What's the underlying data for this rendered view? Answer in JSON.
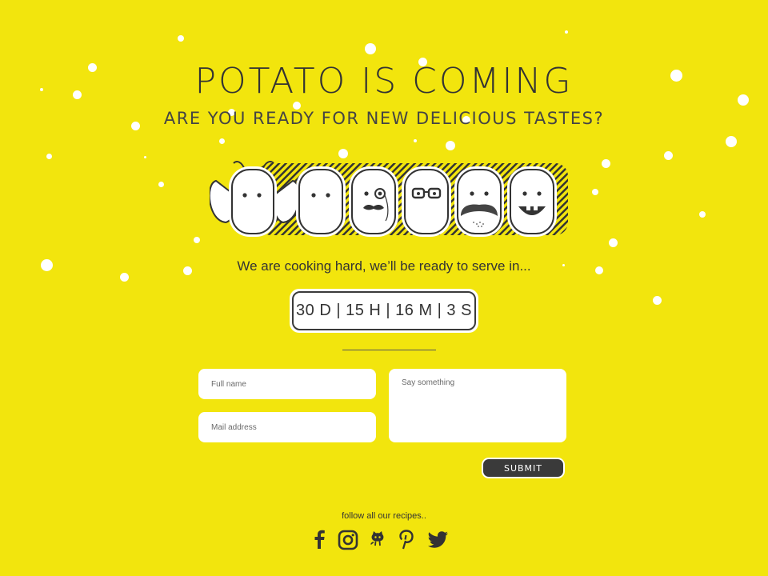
{
  "header": {
    "title": "POTATO IS COMING",
    "subtitle": "ARE YOU READY FOR NEW DELICIOUS TASTES?"
  },
  "illustration": {
    "characters": [
      "bee-potato",
      "plain-potato",
      "monocle-potato",
      "glasses-potato",
      "mustache-potato",
      "smiling-potato"
    ]
  },
  "tagline": "We are cooking hard, we’ll be ready to serve in...",
  "countdown": {
    "text": "30 D | 15 H | 16 M | 3 S"
  },
  "form": {
    "name_placeholder": "Full name",
    "email_placeholder": "Mail address",
    "message_placeholder": "Say something",
    "submit_label": "SUBMIT"
  },
  "footer": {
    "follow_text": "follow all our recipes..",
    "social": [
      "facebook-icon",
      "instagram-icon",
      "github-icon",
      "pinterest-icon",
      "twitter-icon"
    ]
  },
  "colors": {
    "background": "#f2e50d",
    "dark": "#3a3a3a",
    "white": "#ffffff"
  }
}
